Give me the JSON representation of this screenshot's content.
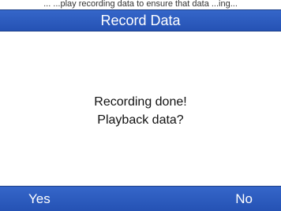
{
  "header": {
    "caption_fragment": "... ...play recording data to ensure that data ...ing...",
    "title": "Record Data"
  },
  "dialog": {
    "line1": "Recording done!",
    "line2": "Playback data?"
  },
  "softkeys": {
    "left_label": "Yes",
    "right_label": "No"
  },
  "colors": {
    "bar_blue": "#2c5cbf",
    "text_dark": "#111111",
    "background": "#ffffff"
  }
}
